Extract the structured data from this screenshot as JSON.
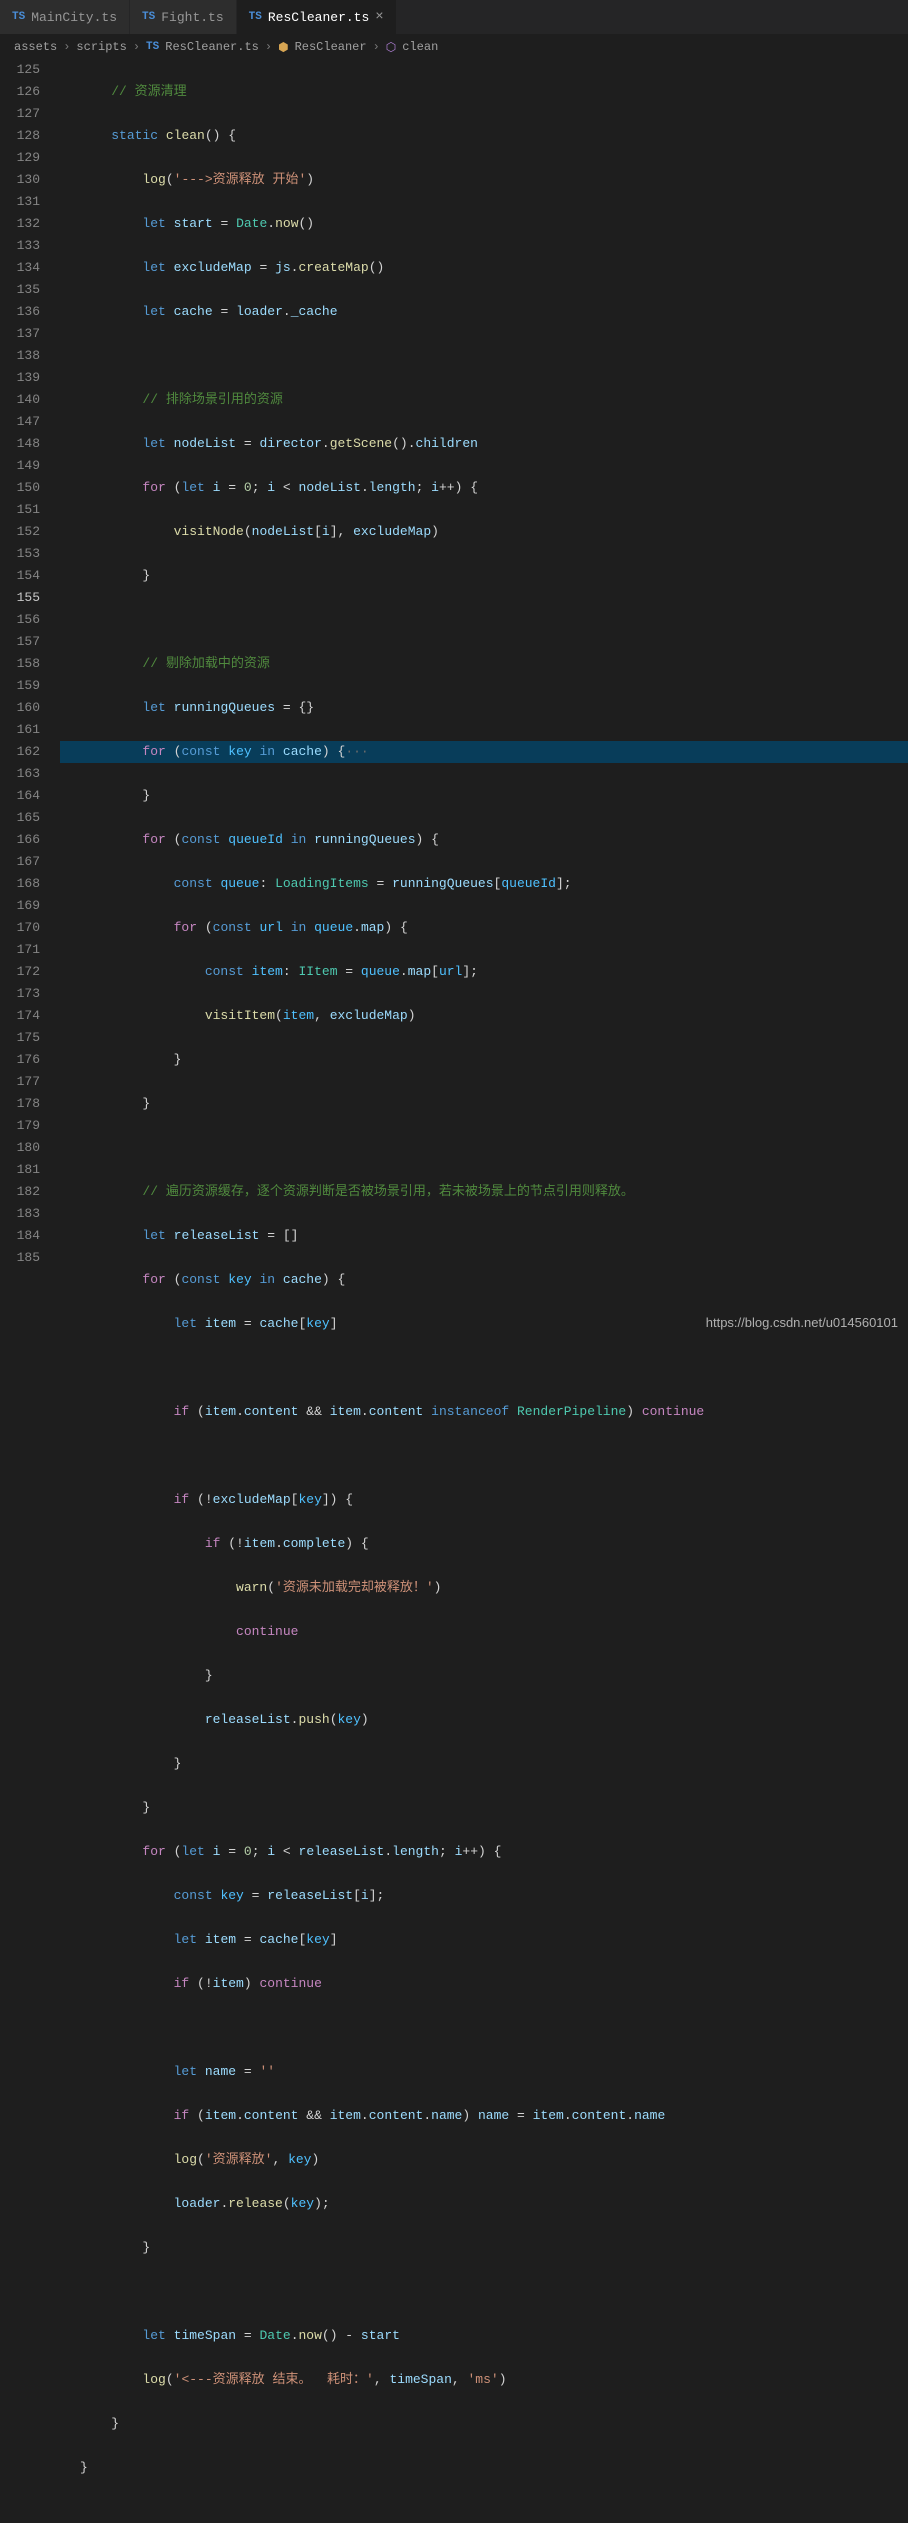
{
  "tabs": [
    {
      "badge": "TS",
      "label": "MainCity.ts",
      "close": false,
      "active": false
    },
    {
      "badge": "TS",
      "label": "Fight.ts",
      "close": false,
      "active": false
    },
    {
      "badge": "TS",
      "label": "ResCleaner.ts",
      "close": true,
      "active": true
    }
  ],
  "breadcrumbs": {
    "items": [
      "assets",
      "scripts",
      "ResCleaner.ts",
      "ResCleaner",
      "clean"
    ]
  },
  "line_numbers": [
    "125",
    "126",
    "127",
    "128",
    "129",
    "130",
    "131",
    "132",
    "133",
    "134",
    "135",
    "136",
    "137",
    "138",
    "139",
    "140",
    "147",
    "148",
    "149",
    "150",
    "151",
    "152",
    "153",
    "154",
    "155",
    "156",
    "157",
    "158",
    "159",
    "160",
    "161",
    "162",
    "163",
    "164",
    "165",
    "166",
    "167",
    "168",
    "169",
    "170",
    "171",
    "172",
    "173",
    "174",
    "175",
    "176",
    "177",
    "178",
    "179",
    "180",
    "181",
    "182",
    "183",
    "184",
    "185"
  ],
  "code": {
    "l125": "// 资源清理",
    "l126_a": "static",
    "l126_b": "clean",
    "l126_c": "() {",
    "l127_a": "log",
    "l127_b": "'--->资源释放 开始'",
    "l128_a": "let",
    "l128_b": "start",
    "l128_c": "Date",
    "l128_d": "now",
    "l129_a": "let",
    "l129_b": "excludeMap",
    "l129_c": "js",
    "l129_d": "createMap",
    "l130_a": "let",
    "l130_b": "cache",
    "l130_c": "loader",
    "l130_d": "_cache",
    "l132": "// 排除场景引用的资源",
    "l133_a": "let",
    "l133_b": "nodeList",
    "l133_c": "director",
    "l133_d": "getScene",
    "l133_e": "children",
    "l134_a": "for",
    "l134_b": "let",
    "l134_c": "i",
    "l134_d": "0",
    "l134_e": "i",
    "l134_f": "nodeList",
    "l134_g": "length",
    "l134_h": "i",
    "l135_a": "visitNode",
    "l135_b": "nodeList",
    "l135_c": "i",
    "l135_d": "excludeMap",
    "l138": "// 剔除加载中的资源",
    "l139_a": "let",
    "l139_b": "runningQueues",
    "l140_a": "for",
    "l140_b": "const",
    "l140_c": "key",
    "l140_d": "in",
    "l140_e": "cache",
    "l140_f": "···",
    "l148_a": "for",
    "l148_b": "const",
    "l148_c": "queueId",
    "l148_d": "in",
    "l148_e": "runningQueues",
    "l149_a": "const",
    "l149_b": "queue",
    "l149_c": "LoadingItems",
    "l149_d": "runningQueues",
    "l149_e": "queueId",
    "l150_a": "for",
    "l150_b": "const",
    "l150_c": "url",
    "l150_d": "in",
    "l150_e": "queue",
    "l150_f": "map",
    "l151_a": "const",
    "l151_b": "item",
    "l151_c": "IItem",
    "l151_d": "queue",
    "l151_e": "map",
    "l151_f": "url",
    "l152_a": "visitItem",
    "l152_b": "item",
    "l152_c": "excludeMap",
    "l156": "// 遍历资源缓存，逐个资源判断是否被场景引用，若未被场景上的节点引用则释放。",
    "l157_a": "let",
    "l157_b": "releaseList",
    "l158_a": "for",
    "l158_b": "const",
    "l158_c": "key",
    "l158_d": "in",
    "l158_e": "cache",
    "l159_a": "let",
    "l159_b": "item",
    "l159_c": "cache",
    "l159_d": "key",
    "l161_a": "if",
    "l161_b": "item",
    "l161_c": "content",
    "l161_d": "item",
    "l161_e": "content",
    "l161_f": "instanceof",
    "l161_g": "RenderPipeline",
    "l161_h": "continue",
    "l163_a": "if",
    "l163_b": "excludeMap",
    "l163_c": "key",
    "l164_a": "if",
    "l164_b": "item",
    "l164_c": "complete",
    "l165_a": "warn",
    "l165_b": "'资源未加载完却被释放！'",
    "l166": "continue",
    "l168_a": "releaseList",
    "l168_b": "push",
    "l168_c": "key",
    "l171_a": "for",
    "l171_b": "let",
    "l171_c": "i",
    "l171_d": "0",
    "l171_e": "i",
    "l171_f": "releaseList",
    "l171_g": "length",
    "l171_h": "i",
    "l172_a": "const",
    "l172_b": "key",
    "l172_c": "releaseList",
    "l172_d": "i",
    "l173_a": "let",
    "l173_b": "item",
    "l173_c": "cache",
    "l173_d": "key",
    "l174_a": "if",
    "l174_b": "item",
    "l174_c": "continue",
    "l176_a": "let",
    "l176_b": "name",
    "l176_c": "''",
    "l177_a": "if",
    "l177_b": "item",
    "l177_c": "content",
    "l177_d": "item",
    "l177_e": "content",
    "l177_f": "name",
    "l177_g": "name",
    "l177_h": "item",
    "l177_i": "content",
    "l177_j": "name",
    "l178_a": "log",
    "l178_b": "'资源释放'",
    "l178_c": "key",
    "l179_a": "loader",
    "l179_b": "release",
    "l179_c": "key",
    "l182_a": "let",
    "l182_b": "timeSpan",
    "l182_c": "Date",
    "l182_d": "now",
    "l182_e": "start",
    "l183_a": "log",
    "l183_b": "'<---资源释放 结束。  耗时：'",
    "l183_c": "timeSpan",
    "l183_d": "'ms'"
  },
  "watermark": "https://blog.csdn.net/u014560101"
}
